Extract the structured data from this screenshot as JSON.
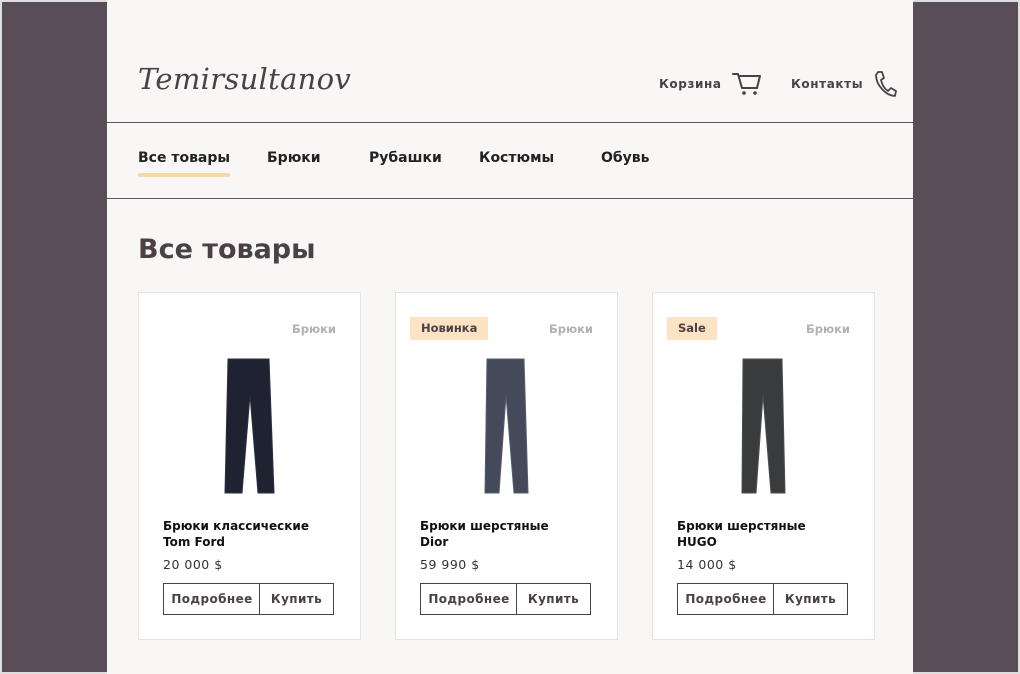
{
  "header": {
    "logo": "Temirsultanov",
    "cart_label": "Корзина",
    "contacts_label": "Контакты"
  },
  "nav": {
    "items": [
      {
        "label": "Все товары",
        "active": true
      },
      {
        "label": "Брюки"
      },
      {
        "label": "Рубашки"
      },
      {
        "label": "Костюмы"
      },
      {
        "label": "Обувь"
      }
    ]
  },
  "main": {
    "title": "Все товары",
    "products": [
      {
        "badge": "",
        "category": "Брюки",
        "name_line1": "Брюки классические",
        "name_line2": "Tom Ford",
        "price": "20 000 $",
        "more_label": "Подробнее",
        "buy_label": "Купить",
        "color": "#1f2230",
        "stroke": "#2c3040"
      },
      {
        "badge": "Новинка",
        "category": "Брюки",
        "name_line1": "Брюки шерстяные",
        "name_line2": "Dior",
        "price": "59 990 $",
        "more_label": "Подробнее",
        "buy_label": "Купить",
        "color": "#444a5a",
        "stroke": "#565c6c"
      },
      {
        "badge": "Sale",
        "category": "Брюки",
        "name_line1": "Брюки шерстяные",
        "name_line2": "HUGO",
        "price": "14 000 $",
        "more_label": "Подробнее",
        "buy_label": "Купить",
        "color": "#3a3b3c",
        "stroke": "#4c4d4e"
      }
    ]
  },
  "colors": {
    "side_background": "#594e57",
    "page_background": "#f9f7f6",
    "accent": "#f7d9a8",
    "badge_background": "#fde3c3",
    "text_dark": "#4b4046"
  }
}
